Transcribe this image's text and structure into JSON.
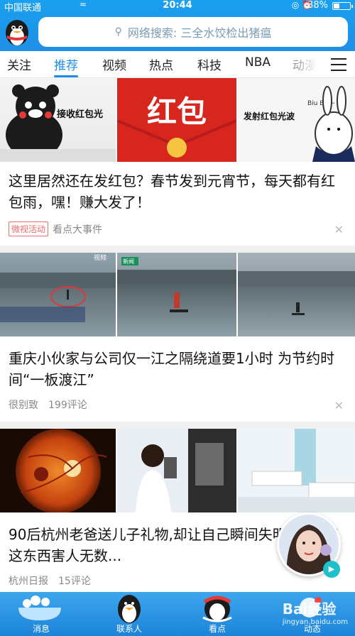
{
  "status_bar": {
    "carrier": "中国联通",
    "time": "20:44",
    "battery": "38%",
    "battery_level": 0.38
  },
  "header": {
    "search_placeholder": "网络搜索: 三全水饺检出猪瘟"
  },
  "tabs": [
    {
      "label": "关注",
      "active": false
    },
    {
      "label": "推荐",
      "active": true
    },
    {
      "label": "视频",
      "active": false
    },
    {
      "label": "热点",
      "active": false
    },
    {
      "label": "科技",
      "active": false
    },
    {
      "label": "NBA",
      "active": false
    },
    {
      "label": "动漫",
      "active": false
    }
  ],
  "feed": [
    {
      "image_texts": [
        "接收红包光",
        "红包",
        "发射红包光波",
        "Biu Biu~"
      ],
      "title": "这里居然还在发红包？春节发到元宵节，每天都有红包雨，嘿！赚大发了！",
      "tag": "微视活动",
      "source": "看点大事件",
      "comments": ""
    },
    {
      "image_texts": [
        "视频",
        "新闻"
      ],
      "title": "重庆小伙家与公司仅一江之隔绕道要1小时 为节约时间“一板渡江”",
      "tag": "",
      "source": "很别致",
      "comments": "199评论"
    },
    {
      "image_texts": [],
      "title": "90后杭州老爸送儿子礼物,却让自己瞬间失明,难恢复!这东西害人无数...",
      "tag": "",
      "source": "杭州日报",
      "comments": "15评论"
    }
  ],
  "bottom_nav": [
    {
      "label": "消息",
      "active": false
    },
    {
      "label": "联系人",
      "active": false
    },
    {
      "label": "看点",
      "active": true
    },
    {
      "label": "动态",
      "active": false
    }
  ],
  "watermark": {
    "brand": "Bai经验",
    "url": "jingyan.baidu.com"
  },
  "colors": {
    "brand_blue": "#1d8de8",
    "tag_red": "#f06a6a"
  }
}
